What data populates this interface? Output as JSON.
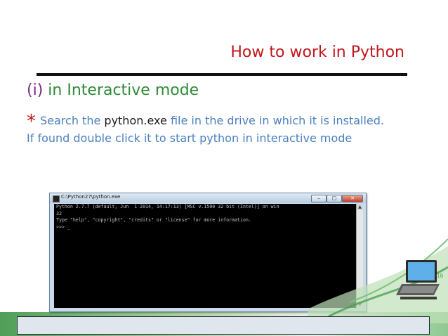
{
  "slide": {
    "title": "How to work in Python",
    "heading_number": "(i)",
    "heading_text": "in Interactive mode",
    "bullet": "*",
    "line1_pre": "Search the",
    "line1_file": "python.exe",
    "line1_post": "file in the drive in which it is installed.",
    "line2": "If found double click it to start python in interactive mode"
  },
  "console_window": {
    "title": "C:\\Python27\\python.exe",
    "lines": [
      "Python 2.7.7 (default, Jun  1 2014, 14:17:13) [MSC v.1500 32 bit (Intel)] on win",
      "32",
      "Type \"help\", \"copyright\", \"credits\" or \"license\" for more information.",
      ">>> _"
    ],
    "min_glyph": "–",
    "max_glyph": "□",
    "close_glyph": "✕"
  },
  "colors": {
    "title": "#c0161c",
    "heading": "#2f8a3a",
    "body": "#4a7fbf"
  }
}
